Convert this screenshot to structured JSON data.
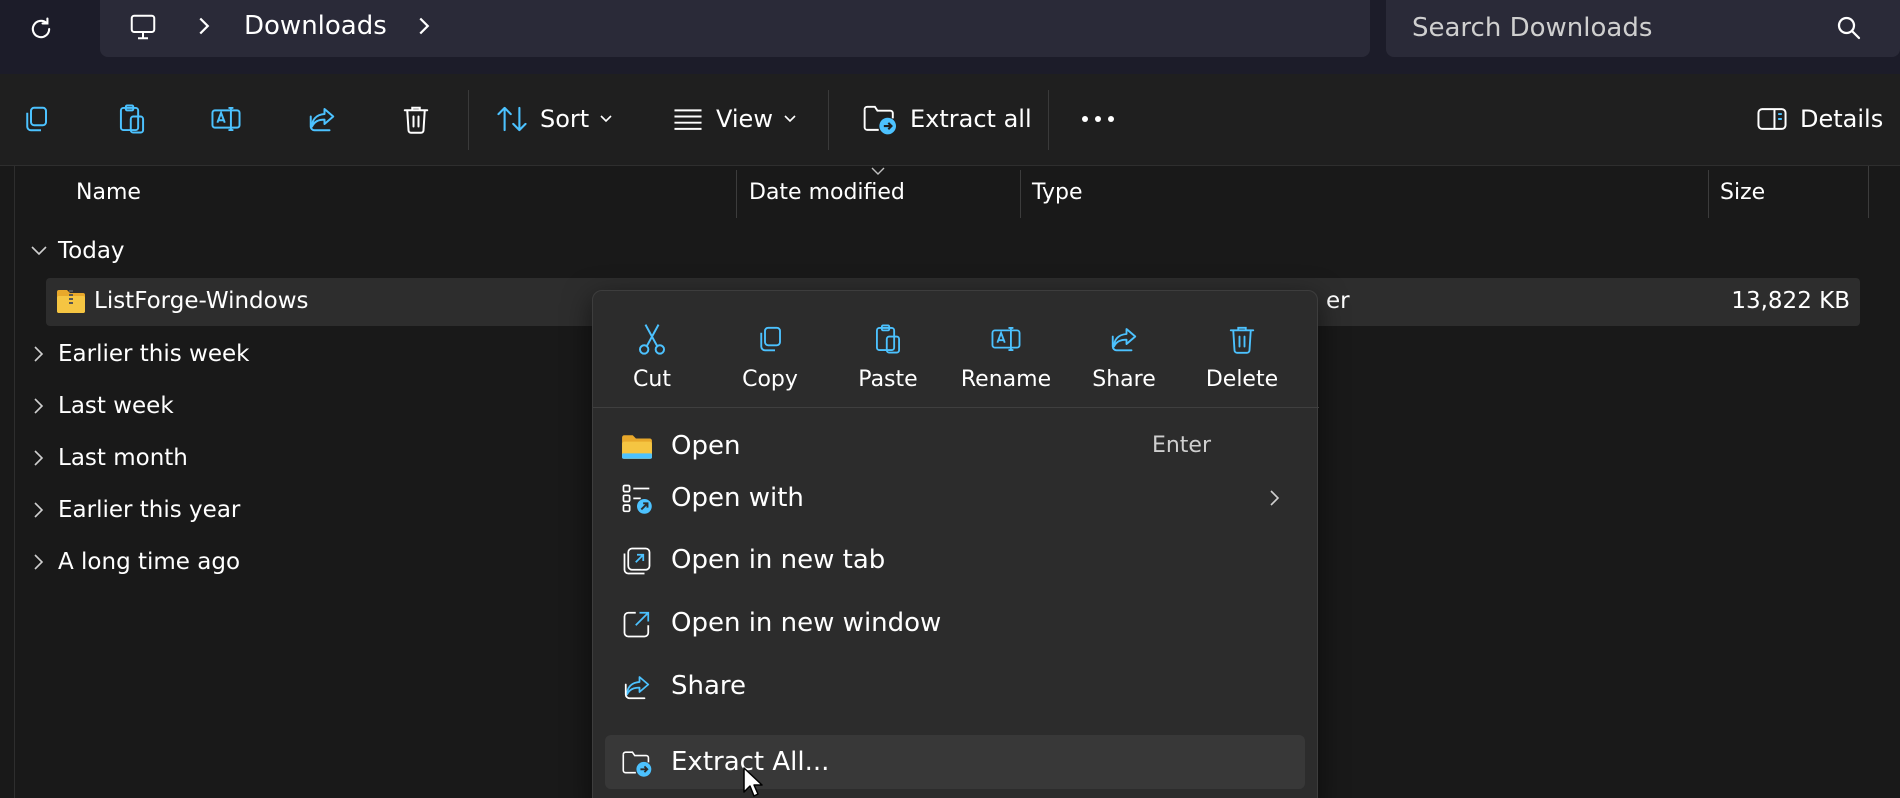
{
  "address": {
    "location": "Downloads",
    "search_placeholder": "Search Downloads"
  },
  "toolbar": {
    "sort_label": "Sort",
    "view_label": "View",
    "extract_all_label": "Extract all",
    "details_label": "Details"
  },
  "columns": {
    "name": "Name",
    "date_modified": "Date modified",
    "type": "Type",
    "size": "Size"
  },
  "groups": {
    "today": "Today",
    "earlier_this_week": "Earlier this week",
    "last_week": "Last week",
    "last_month": "Last month",
    "earlier_this_year": "Earlier this year",
    "long_time_ago": "A long time ago"
  },
  "file": {
    "name": "ListForge-Windows",
    "type_fragment": "er",
    "size": "13,822 KB"
  },
  "context_menu": {
    "quick_actions": [
      {
        "label": "Cut",
        "icon": "scissors-icon"
      },
      {
        "label": "Copy",
        "icon": "copy-icon"
      },
      {
        "label": "Paste",
        "icon": "paste-icon"
      },
      {
        "label": "Rename",
        "icon": "rename-icon"
      },
      {
        "label": "Share",
        "icon": "share-icon"
      },
      {
        "label": "Delete",
        "icon": "trash-icon"
      }
    ],
    "items": [
      {
        "label": "Open",
        "shortcut": "Enter",
        "icon": "folder-icon"
      },
      {
        "label": "Open with",
        "icon": "open-with-icon"
      },
      {
        "label": "Open in new tab",
        "icon": "new-tab-icon"
      },
      {
        "label": "Open in new window",
        "icon": "new-window-icon"
      },
      {
        "label": "Share",
        "icon": "share-icon"
      },
      {
        "label": "Extract All...",
        "icon": "extract-icon"
      }
    ]
  },
  "colors": {
    "accent": "#4cc2ff",
    "folder_yellow": "#f5c542",
    "menu_bg": "#2c2c2c",
    "window_bg": "#191919"
  }
}
